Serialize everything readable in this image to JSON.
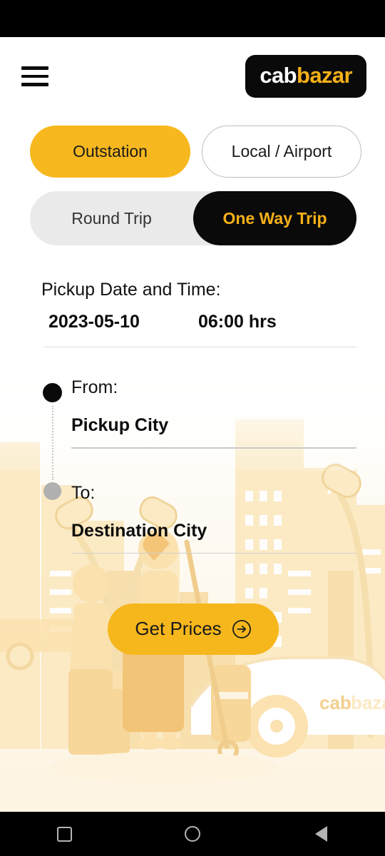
{
  "app": {
    "logo": {
      "part1": "cab",
      "part2": "bazar",
      "icon": "cabbazar-logo"
    },
    "menu_icon": "hamburger-menu-icon"
  },
  "service_tabs": [
    {
      "label": "Outstation",
      "selected": true
    },
    {
      "label": "Local / Airport",
      "selected": false
    }
  ],
  "trip_types": [
    {
      "label": "Round Trip",
      "selected": false
    },
    {
      "label": "One Way Trip",
      "selected": true
    }
  ],
  "pickup": {
    "label": "Pickup Date and Time:",
    "date": "2023-05-10",
    "time": "06:00 hrs"
  },
  "route": {
    "from": {
      "label": "From:",
      "value": "Pickup City",
      "marker": "origin-dot"
    },
    "to": {
      "label": "To:",
      "value": "Destination City",
      "marker": "destination-dot"
    }
  },
  "cta": {
    "label": "Get Prices",
    "icon": "arrow-right-circle-icon"
  },
  "system_nav": {
    "recents": "recents-square-icon",
    "home": "home-circle-icon",
    "back": "back-triangle-icon"
  },
  "colors": {
    "accent": "#f7b81f",
    "accent_text": "#f5b019",
    "dark": "#0a0a0a",
    "segment_bg": "#eaeaea"
  }
}
